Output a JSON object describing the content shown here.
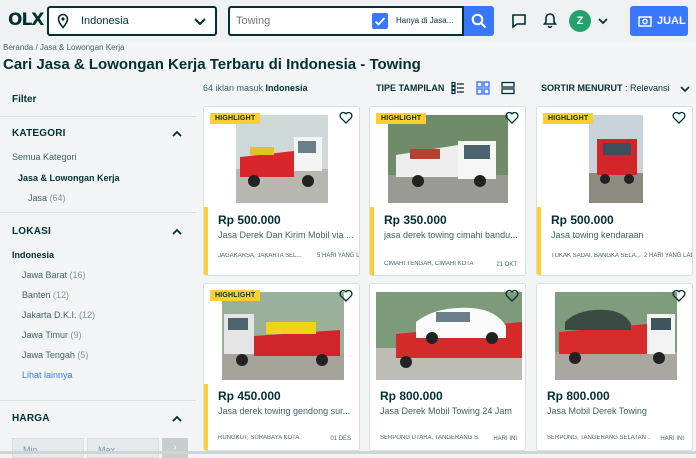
{
  "header": {
    "logo": "OLX",
    "location_value": "Indonesia",
    "search_placeholder": "Towing",
    "checkbox_label": "Hanya di Jasa...",
    "avatar_initial": "Z",
    "sell_label": "JUAL"
  },
  "breadcrumb": "Beranda / Jasa & Lowongan Kerja",
  "page_title": "Cari Jasa & Lowongan Kerja Terbaru di Indonesia - Towing",
  "sidebar": {
    "filter": "Filter",
    "kategori": {
      "title": "KATEGORI",
      "all": "Semua Kategori",
      "selected": "Jasa & Lowongan Kerja",
      "sub_label": "Jasa",
      "sub_count": "(64)"
    },
    "lokasi": {
      "title": "LOKASI",
      "selected": "Indonesia",
      "items": [
        {
          "label": "Jawa Barat",
          "count": "(16)"
        },
        {
          "label": "Banten",
          "count": "(12)"
        },
        {
          "label": "Jakarta D.K.I.",
          "count": "(12)"
        },
        {
          "label": "Jawa Timur",
          "count": "(9)"
        },
        {
          "label": "Jawa Tengah",
          "count": "(5)"
        }
      ],
      "more": "Lihat lainnya"
    },
    "harga": {
      "title": "HARGA",
      "min": "Min",
      "max": "Max",
      "go": "›"
    }
  },
  "toolbar": {
    "count_prefix": "64 iklan masuk",
    "count_location": "Indonesia",
    "view_label": "TIPE TAMPILAN",
    "sort_label": "SORTIR MENURUT",
    "sort_value": ": Relevansi"
  },
  "listings": [
    {
      "badge": "HIGHLIGHT",
      "price": "Rp 500.000",
      "title": "Jasa Derek Dan Kirim Mobil via ...",
      "location": "JAGAKARSA, JAKARTA SEL...",
      "date": "5 HARI YANG LALU"
    },
    {
      "badge": "HIGHLIGHT",
      "price": "Rp 350.000",
      "title": "jasa derek towing cimahi bandu...",
      "location": "CIMAHI TENGAH, CIMAHI KOTA",
      "date": "21 OKT"
    },
    {
      "badge": "HIGHLIGHT",
      "price": "Rp 500.000",
      "title": "Jasa towing kendaraan",
      "location": "TUKAK SADAI, BANGKA SELA...",
      "date": "2 HARI YANG LALU"
    },
    {
      "badge": "HIGHLIGHT",
      "price": "Rp 450.000",
      "title": "Jasa derek towing gendong sur...",
      "location": "RUNGKUT, SURABAYA KOTA",
      "date": "01 DES"
    },
    {
      "badge": "",
      "price": "Rp 800.000",
      "title": "Jasa Derek Mobil Towing 24 Jam",
      "location": "SERPONG UTARA, TANGERANG S...",
      "date": "HARI INI"
    },
    {
      "badge": "",
      "price": "Rp 800.000",
      "title": "Jasa Mobil Derek Towing",
      "location": "SERPONG, TANGERANG SELATAN ...",
      "date": "HARI INI"
    }
  ],
  "colors": {
    "brand_dark": "#002f34",
    "accent_blue": "#3a77ff",
    "highlight_yellow": "#ffce32",
    "avatar_green": "#23a36c"
  }
}
